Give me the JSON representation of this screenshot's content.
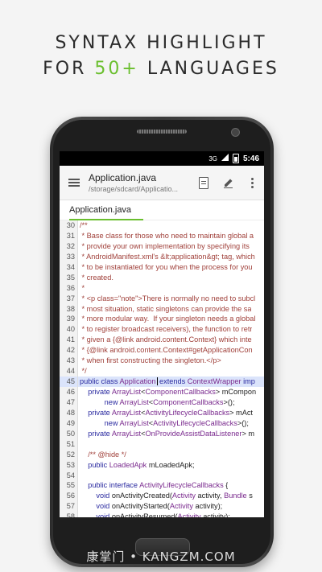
{
  "headline": {
    "line1": "SYNTAX HIGHLIGHT",
    "line2_pre": "FOR ",
    "line2_accent": "50+",
    "line2_post": " LANGUAGES"
  },
  "status": {
    "network": "3G",
    "time": "5:46"
  },
  "toolbar": {
    "title": "Application.java",
    "path": "/storage/sdcard/Applicatio..."
  },
  "tabs": [
    {
      "label": "Application.java"
    }
  ],
  "code_lines": [
    {
      "n": "30",
      "segs": [
        {
          "c": "comment",
          "t": "/**"
        }
      ]
    },
    {
      "n": "31",
      "segs": [
        {
          "c": "comment",
          "t": " * Base class for those who need to maintain global a"
        }
      ]
    },
    {
      "n": "32",
      "segs": [
        {
          "c": "comment",
          "t": " * provide your own implementation by specifying its"
        }
      ]
    },
    {
      "n": "33",
      "segs": [
        {
          "c": "comment",
          "t": " * AndroidManifest.xml's &lt;application&gt; tag, which"
        }
      ]
    },
    {
      "n": "34",
      "segs": [
        {
          "c": "comment",
          "t": " * to be instantiated for you when the process for you"
        }
      ]
    },
    {
      "n": "35",
      "segs": [
        {
          "c": "comment",
          "t": " * created."
        }
      ]
    },
    {
      "n": "36",
      "segs": [
        {
          "c": "comment",
          "t": " *"
        }
      ]
    },
    {
      "n": "37",
      "segs": [
        {
          "c": "comment",
          "t": " * <p class=\"note\">There is normally no need to subcl"
        }
      ]
    },
    {
      "n": "38",
      "segs": [
        {
          "c": "comment",
          "t": " * most situation, static singletons can provide the sa"
        }
      ]
    },
    {
      "n": "39",
      "segs": [
        {
          "c": "comment",
          "t": " * more modular way.  If your singleton needs a global"
        }
      ]
    },
    {
      "n": "40",
      "segs": [
        {
          "c": "comment",
          "t": " * to register broadcast receivers), the function to retr"
        }
      ]
    },
    {
      "n": "41",
      "segs": [
        {
          "c": "comment",
          "t": " * given a {@link android.content.Context} which inte"
        }
      ]
    },
    {
      "n": "42",
      "segs": [
        {
          "c": "comment",
          "t": " * {@link android.content.Context#getApplicationCon"
        }
      ]
    },
    {
      "n": "43",
      "segs": [
        {
          "c": "comment",
          "t": " * when first constructing the singleton.</p>"
        }
      ]
    },
    {
      "n": "44",
      "segs": [
        {
          "c": "comment",
          "t": " */"
        }
      ]
    },
    {
      "n": "45",
      "current": true,
      "segs": [
        {
          "c": "kw",
          "t": "public class "
        },
        {
          "c": "type",
          "t": "Application"
        },
        {
          "c": "caret",
          "t": ""
        },
        {
          "c": "kw",
          "t": " extends "
        },
        {
          "c": "type",
          "t": "ContextWrapper"
        },
        {
          "c": "kw",
          "t": " imp"
        }
      ]
    },
    {
      "n": "46",
      "segs": [
        {
          "c": "kw",
          "t": "    private "
        },
        {
          "c": "type",
          "t": "ArrayList"
        },
        {
          "c": "plain",
          "t": "<"
        },
        {
          "c": "type",
          "t": "ComponentCallbacks"
        },
        {
          "c": "plain",
          "t": "> mCompon"
        }
      ]
    },
    {
      "n": "47",
      "segs": [
        {
          "c": "kw",
          "t": "            new "
        },
        {
          "c": "type",
          "t": "ArrayList"
        },
        {
          "c": "plain",
          "t": "<"
        },
        {
          "c": "type",
          "t": "ComponentCallbacks"
        },
        {
          "c": "plain",
          "t": ">();"
        }
      ]
    },
    {
      "n": "48",
      "segs": [
        {
          "c": "kw",
          "t": "    private "
        },
        {
          "c": "type",
          "t": "ArrayList"
        },
        {
          "c": "plain",
          "t": "<"
        },
        {
          "c": "type",
          "t": "ActivityLifecycleCallbacks"
        },
        {
          "c": "plain",
          "t": "> mAct"
        }
      ]
    },
    {
      "n": "49",
      "segs": [
        {
          "c": "kw",
          "t": "            new "
        },
        {
          "c": "type",
          "t": "ArrayList"
        },
        {
          "c": "plain",
          "t": "<"
        },
        {
          "c": "type",
          "t": "ActivityLifecycleCallbacks"
        },
        {
          "c": "plain",
          "t": ">();"
        }
      ]
    },
    {
      "n": "50",
      "segs": [
        {
          "c": "kw",
          "t": "    private "
        },
        {
          "c": "type",
          "t": "ArrayList"
        },
        {
          "c": "plain",
          "t": "<"
        },
        {
          "c": "type",
          "t": "OnProvideAssistDataListener"
        },
        {
          "c": "plain",
          "t": "> m"
        }
      ]
    },
    {
      "n": "51",
      "segs": [
        {
          "c": "plain",
          "t": ""
        }
      ]
    },
    {
      "n": "52",
      "segs": [
        {
          "c": "comment",
          "t": "    /** @hide */"
        }
      ]
    },
    {
      "n": "53",
      "segs": [
        {
          "c": "kw",
          "t": "    public "
        },
        {
          "c": "type",
          "t": "LoadedApk"
        },
        {
          "c": "plain",
          "t": " mLoadedApk;"
        }
      ]
    },
    {
      "n": "54",
      "segs": [
        {
          "c": "plain",
          "t": ""
        }
      ]
    },
    {
      "n": "55",
      "segs": [
        {
          "c": "kw",
          "t": "    public interface "
        },
        {
          "c": "type",
          "t": "ActivityLifecycleCallbacks"
        },
        {
          "c": "plain",
          "t": " {"
        }
      ]
    },
    {
      "n": "56",
      "segs": [
        {
          "c": "kw",
          "t": "        void "
        },
        {
          "c": "plain",
          "t": "onActivityCreated("
        },
        {
          "c": "type",
          "t": "Activity"
        },
        {
          "c": "plain",
          "t": " activity, "
        },
        {
          "c": "type",
          "t": "Bundle"
        },
        {
          "c": "plain",
          "t": " s"
        }
      ]
    },
    {
      "n": "57",
      "segs": [
        {
          "c": "kw",
          "t": "        void "
        },
        {
          "c": "plain",
          "t": "onActivityStarted("
        },
        {
          "c": "type",
          "t": "Activity"
        },
        {
          "c": "plain",
          "t": " activity);"
        }
      ]
    },
    {
      "n": "58",
      "segs": [
        {
          "c": "kw",
          "t": "        void "
        },
        {
          "c": "plain",
          "t": "onActivityResumed("
        },
        {
          "c": "type",
          "t": "Activity"
        },
        {
          "c": "plain",
          "t": " activity);"
        }
      ]
    }
  ],
  "watermark": "康掌门 • KANGZM.COM",
  "colors": {
    "accent": "#6abf2e",
    "comment": "#a0403a",
    "keyword": "#2a2aa0",
    "type": "#7a2a8e"
  }
}
